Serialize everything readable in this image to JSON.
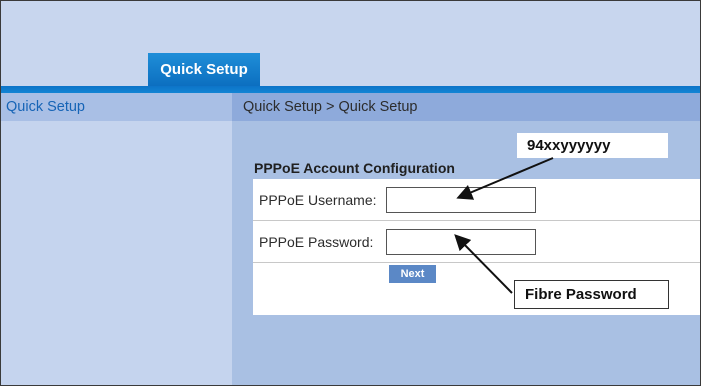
{
  "nav": {
    "active_tab": "Quick Setup"
  },
  "sidebar": {
    "header": "Quick Setup"
  },
  "main": {
    "breadcrumb": "Quick Setup > Quick Setup",
    "section_title": "PPPoE Account Configuration",
    "username_label": "PPPoE Username:",
    "username_value": "",
    "password_label": "PPPoE Password:",
    "password_value": "",
    "next_label": "Next"
  },
  "annotations": {
    "username_callout": "94xxyyyyyy",
    "password_callout": "Fibre Password"
  },
  "colors": {
    "accent": "#0c6fc0",
    "nav_bar": "#1385d4",
    "button": "#5b88c6"
  }
}
